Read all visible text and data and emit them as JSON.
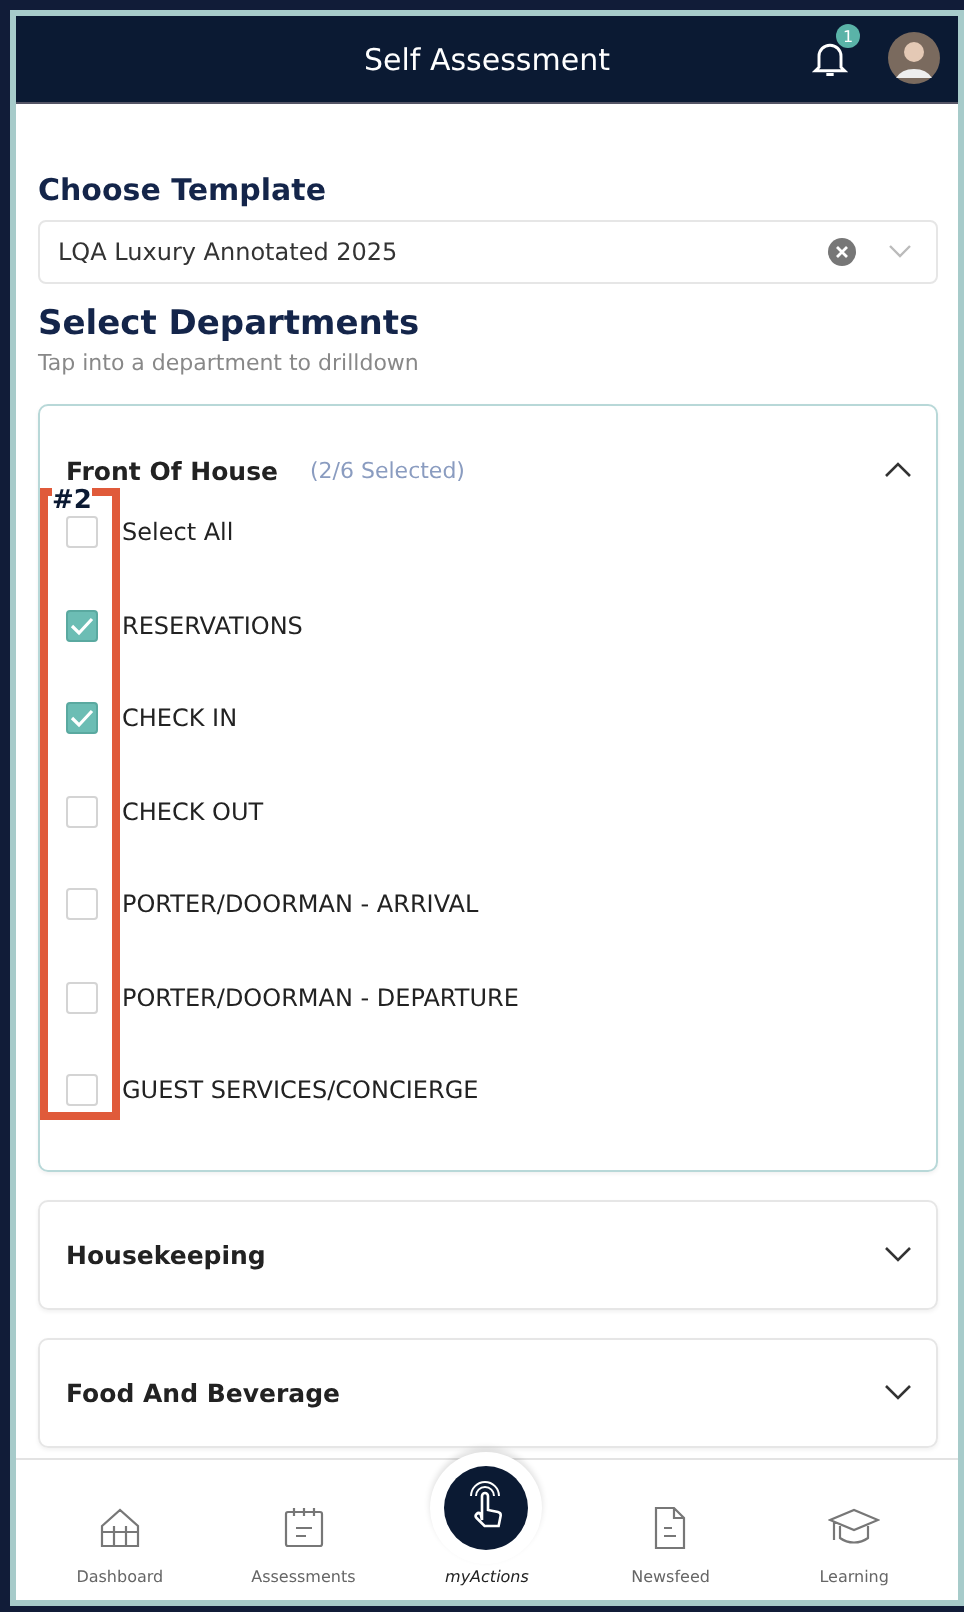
{
  "header": {
    "title": "Self Assessment",
    "notification_count": "1"
  },
  "template": {
    "label": "Choose Template",
    "value": "LQA Luxury Annotated 2025"
  },
  "departments_heading": {
    "title": "Select Departments",
    "hint": "Tap into a department to drilldown"
  },
  "departments": [
    {
      "name": "Front Of House",
      "count": "(2/6 Selected)",
      "expanded": true,
      "items": [
        {
          "label": "Select All",
          "checked": false
        },
        {
          "label": "RESERVATIONS",
          "checked": true
        },
        {
          "label": "CHECK IN",
          "checked": true
        },
        {
          "label": "CHECK OUT",
          "checked": false
        },
        {
          "label": "PORTER/DOORMAN - ARRIVAL",
          "checked": false
        },
        {
          "label": "PORTER/DOORMAN - DEPARTURE",
          "checked": false
        },
        {
          "label": "GUEST SERVICES/CONCIERGE",
          "checked": false
        }
      ]
    },
    {
      "name": "Housekeeping",
      "expanded": false
    },
    {
      "name": "Food And Beverage",
      "expanded": false
    }
  ],
  "annotation": {
    "label": "#2"
  },
  "nav": [
    {
      "label": "Dashboard",
      "kind": "tab",
      "selected": false
    },
    {
      "label": "Assessments",
      "kind": "tab",
      "selected": false
    },
    {
      "label": "myActions",
      "kind": "center",
      "selected": true
    },
    {
      "label": "Newsfeed",
      "kind": "tab",
      "selected": false
    },
    {
      "label": "Learning",
      "kind": "tab",
      "selected": false
    }
  ]
}
